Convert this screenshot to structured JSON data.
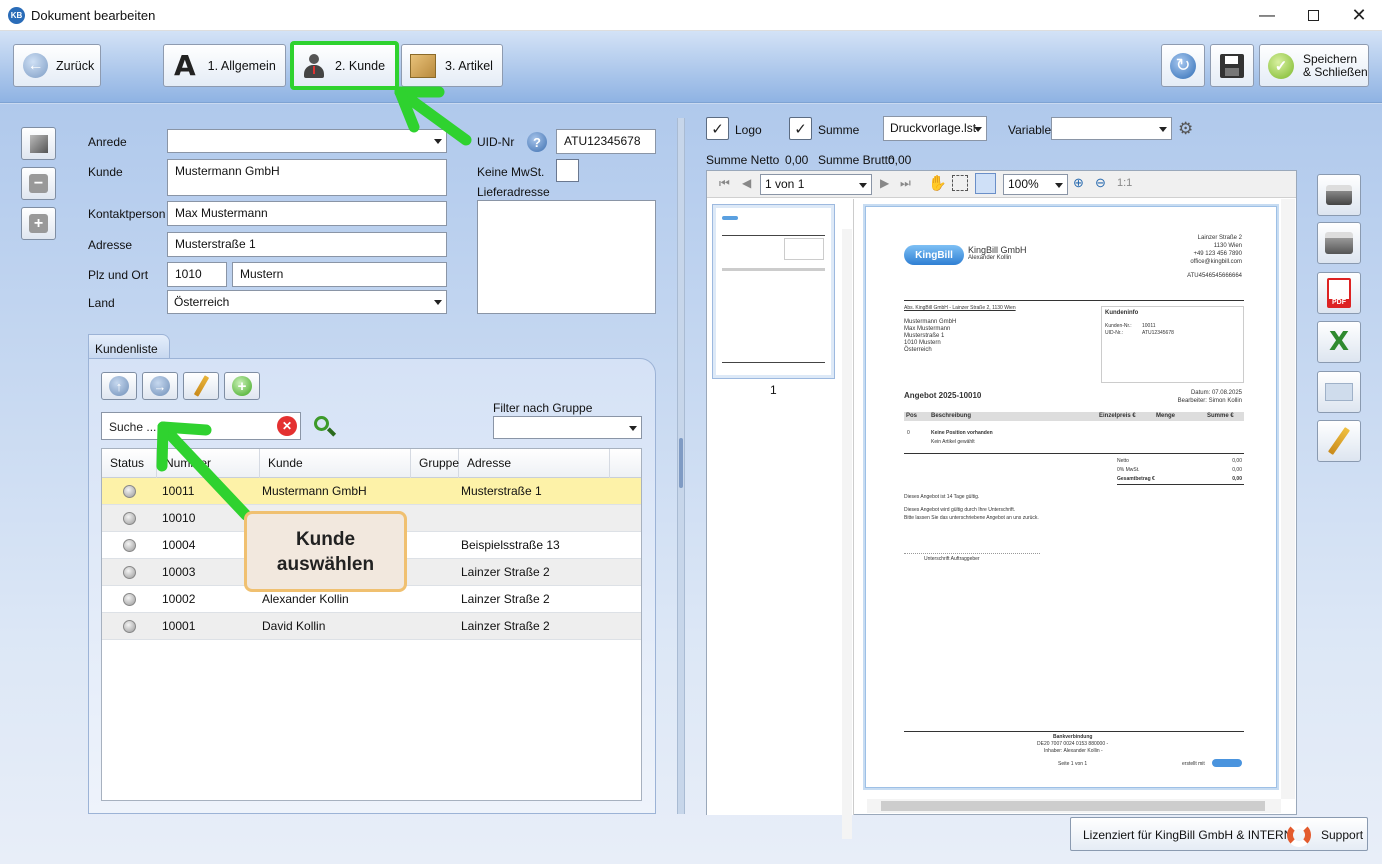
{
  "window": {
    "title": "Dokument bearbeiten",
    "logo": "KB"
  },
  "toolbar": {
    "back_label": "Zurück",
    "tab1_label": "1. Allgemein",
    "tab2_label": "2. Kunde",
    "tab3_label": "3. Artikel",
    "save_close_label_line1": "Speichern",
    "save_close_label_line2": "& Schließen"
  },
  "form": {
    "anrede_label": "Anrede",
    "anrede_value": "",
    "kunde_label": "Kunde",
    "kunde_value": "Mustermann GmbH",
    "kontakt_label": "Kontaktperson",
    "kontakt_value": "Max Mustermann",
    "adresse_label": "Adresse",
    "adresse_value": "Musterstraße 1",
    "plzort_label": "Plz und Ort",
    "plz_value": "1010",
    "ort_value": "Mustern",
    "land_label": "Land",
    "land_value": "Österreich",
    "uid_label": "UID-Nr",
    "uid_value": "ATU12345678",
    "keine_mwst_label": "Keine MwSt.",
    "lieferadresse_label": "Lieferadresse"
  },
  "kundenliste": {
    "tab_label": "Kundenliste",
    "search_placeholder": "Suche ...",
    "filter_label": "Filter nach Gruppe",
    "columns": [
      "Status",
      "Nummer",
      "Kunde",
      "Gruppe",
      "Adresse"
    ],
    "rows": [
      {
        "nummer": "10011",
        "kunde": "Mustermann GmbH",
        "gruppe": "",
        "adresse": "Musterstraße 1"
      },
      {
        "nummer": "10010",
        "kunde": "",
        "gruppe": "",
        "adresse": ""
      },
      {
        "nummer": "10004",
        "kunde": "",
        "gruppe": "",
        "adresse": "Beispielsstraße 13"
      },
      {
        "nummer": "10003",
        "kunde": "",
        "gruppe": "",
        "adresse": "Lainzer Straße 2"
      },
      {
        "nummer": "10002",
        "kunde": "Alexander Kollin",
        "gruppe": "",
        "adresse": "Lainzer Straße 2"
      },
      {
        "nummer": "10001",
        "kunde": "David Kollin",
        "gruppe": "",
        "adresse": "Lainzer Straße 2"
      }
    ]
  },
  "callout": {
    "line1": "Kunde",
    "line2": "auswählen"
  },
  "preview_opts": {
    "logo_label": "Logo",
    "summe_label": "Summe",
    "vorlage_value": "Druckvorlage.lst",
    "variable_label": "Variable",
    "summe_netto_label": "Summe Netto",
    "summe_netto_value": "0,00",
    "summe_brutto_label": "Summe Brutto",
    "summe_brutto_value": "0,00",
    "page_value": "1 von 1",
    "zoom_value": "100%",
    "zoom_1to1": "1:1",
    "thumb_page": "1"
  },
  "document": {
    "company": "KingBill GmbH",
    "person": "Alexander Kollin",
    "logo_text": "KingBill",
    "addr1": "Lainzer Straße 2",
    "addr2": "1130 Wien",
    "phone": "+49 123 456 7890",
    "email": "office@kingbill.com",
    "uid": "ATU4546545666664",
    "sender_line": "Abs. KingBill GmbH - Lainzer Straße 2, 1130 Wien",
    "recipient": [
      "Mustermann GmbH",
      "Max Mustermann",
      "Musterstraße 1",
      "1010 Mustern",
      "Österreich"
    ],
    "kundeninfo_title": "Kundeninfo",
    "kundennr_label": "Kunden-Nr.:",
    "kundennr": "10011",
    "uidnr_label": "UID-Nr.:",
    "uidnr": "ATU12345678",
    "offer_title": "Angebot 2025-10010",
    "date_line": "Datum: 07.08.2025",
    "editor_line": "Bearbeiter: Simon Kollin",
    "col_pos": "Pos",
    "col_beschreibung": "Beschreibung",
    "col_einzelpreis": "Einzelpreis €",
    "col_menge": "Menge",
    "col_summe": "Summe €",
    "pos0": "0",
    "no_position": "Keine Position vorhanden",
    "no_article": "Kein Artikel gewählt",
    "netto_label": "Netto",
    "netto": "0,00",
    "mwst_label": "0% MwSt.",
    "mwst": "0,00",
    "gesamt_label": "Gesamtbetrag €",
    "gesamt": "0,00",
    "validity": "Dieses Angebot ist 14 Tage gültig.",
    "sign_note1": "Dieses Angebot wird gültig durch Ihre Unterschrift.",
    "sign_note2": "Bitte lassen Sie das unterschriebene Angebot an uns zurück.",
    "sign_label": "Unterschrift Auftraggeber",
    "bank_title": "Bankverbindung",
    "bank_line1": "DE20 7007 0024 0153 880000 -",
    "bank_line2": "Inhaber: Alexander Kollin -",
    "page_footer": "Seite 1 von 1",
    "created_with": "erstellt mit"
  },
  "footer": {
    "license": "Lizenziert für KingBill GmbH & INTERN",
    "support": "Support"
  }
}
